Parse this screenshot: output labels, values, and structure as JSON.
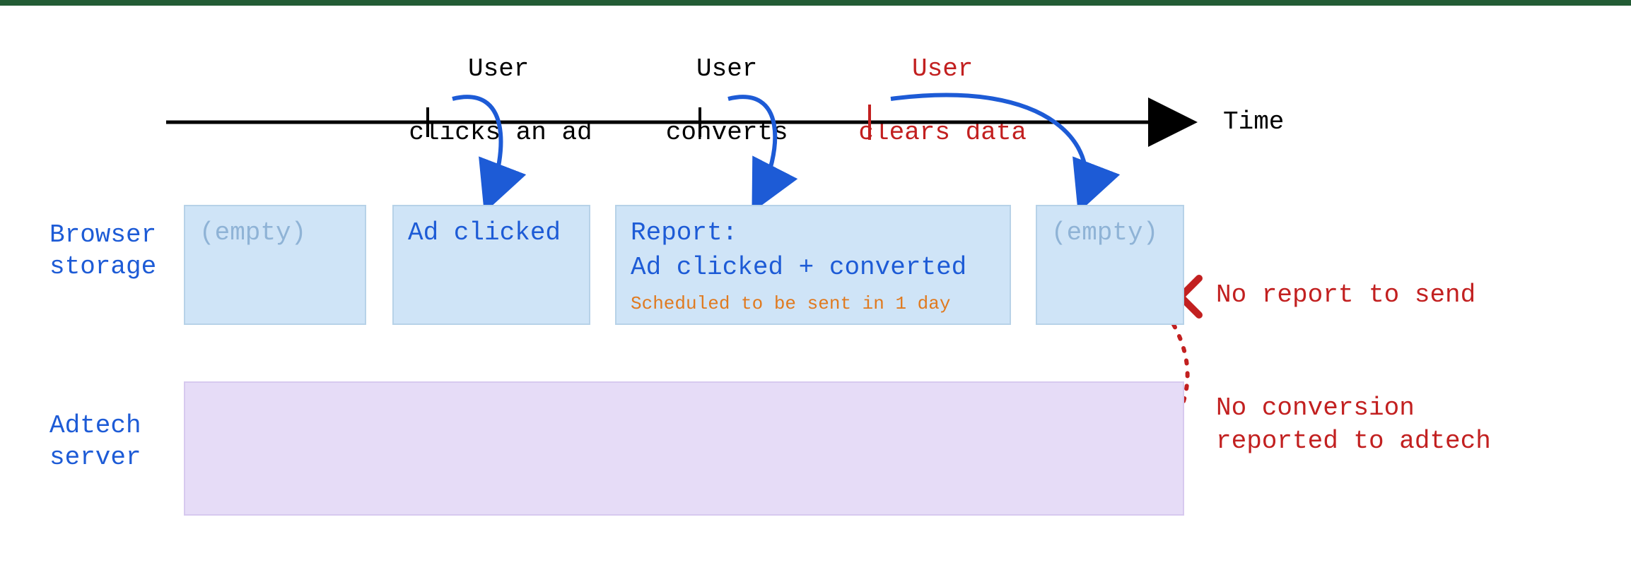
{
  "timeline": {
    "axis_label": "Time",
    "events": [
      {
        "id": "click",
        "line1": "User",
        "line2": "clicks an ad",
        "color": "black"
      },
      {
        "id": "convert",
        "line1": "User",
        "line2": "converts",
        "color": "black"
      },
      {
        "id": "clear",
        "line1": "User",
        "line2": "clears data",
        "color": "red"
      }
    ]
  },
  "rows": {
    "browser_label": "Browser\nstorage",
    "adtech_label": "Adtech\nserver"
  },
  "boxes": {
    "empty1": "(empty)",
    "ad_clicked": "Ad clicked",
    "report_line1": "Report:",
    "report_line2": "Ad clicked + converted",
    "report_schedule": "Scheduled to be sent in 1 day",
    "empty2": "(empty)"
  },
  "errors": {
    "no_report": "No report to send",
    "no_conversion": "No conversion\nreported to adtech"
  }
}
